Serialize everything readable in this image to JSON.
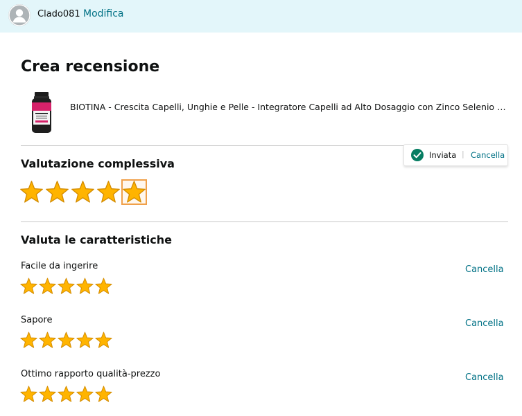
{
  "header": {
    "username": "Clado081",
    "edit_label": "Modifica"
  },
  "page": {
    "title": "Crea recensione"
  },
  "product": {
    "title": "BIOTINA - Crescita Capelli, Unghie e Pelle - Integratore Capelli ad Alto Dosaggio con Zinco Selenio e Vitamine B"
  },
  "status": {
    "text": "Inviata",
    "separator": "|",
    "cancel_label": "Cancella"
  },
  "overall": {
    "heading": "Valutazione complessiva",
    "rating": 5,
    "max": 5
  },
  "features": {
    "heading": "Valuta le caratteristiche",
    "items": [
      {
        "label": "Facile da ingerire",
        "rating": 5,
        "max": 5,
        "cancel_label": "Cancella"
      },
      {
        "label": "Sapore",
        "rating": 5,
        "max": 5,
        "cancel_label": "Cancella"
      },
      {
        "label": "Ottimo rapporto qualità-prezzo",
        "rating": 5,
        "max": 5,
        "cancel_label": "Cancella"
      }
    ]
  },
  "colors": {
    "star_fill": "#ffb400",
    "star_stroke": "#d48c00",
    "link": "#007185",
    "header_bg": "#e3f6fa",
    "check_green": "#067d62"
  }
}
